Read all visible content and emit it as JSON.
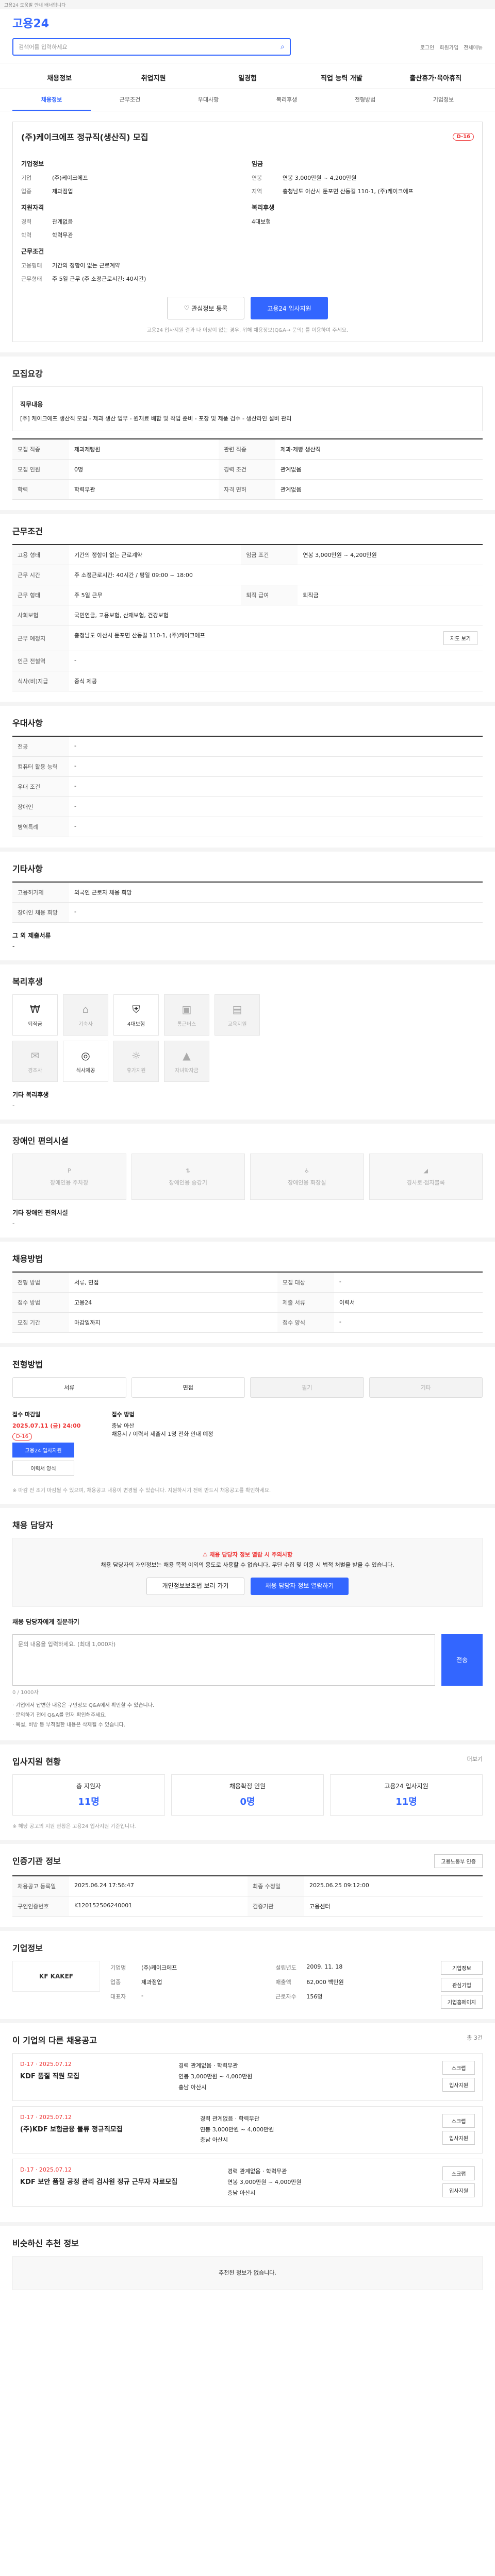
{
  "topbar": {
    "text": "고용24 도움말 안내 배너입니다"
  },
  "search": {
    "placeholder": "검색어를 입력하세요",
    "icon": "search-icon"
  },
  "util": [
    "로그인",
    "회원가입",
    "전체메뉴"
  ],
  "logo": "고용24",
  "gnb": [
    "채용정보",
    "취업지원",
    "일경험",
    "직업 능력 개발",
    "출산휴가·육아휴직"
  ],
  "tabs": [
    "채용정보",
    "근무조건",
    "우대사항",
    "복리후생",
    "전형방법",
    "기업정보"
  ],
  "job": {
    "title": "(주)케이크에프 정규직(생산직) 모집",
    "dday": "D-16",
    "company_label": "기업정보",
    "company_rows": [
      {
        "k": "기업",
        "v": "(주)케이크에프"
      },
      {
        "k": "업종",
        "v": "제과점업"
      }
    ],
    "cond_label": "근무조건",
    "cond_rows": [
      {
        "k": "고용형태",
        "v": "기간의 정함이 없는 근로계약"
      },
      {
        "k": "근무형태",
        "v": "주 5일 근무 (주 소정근로시간: 40시간)"
      }
    ],
    "req_label": "지원자격",
    "req_rows": [
      {
        "k": "경력",
        "v": "관계없음"
      },
      {
        "k": "학력",
        "v": "학력무관"
      }
    ],
    "wage_label": "임금",
    "wage_rows": [
      {
        "k": "연봉",
        "v": "연봉 3,000만원 ~ 4,200만원"
      },
      {
        "k": "지역",
        "v": "충청남도 아산시 둔포면 산동길 110-1, (주)케이크에프"
      }
    ],
    "welfare_label": "복리후생",
    "welfare_rows": [
      {
        "k": "",
        "v": "4대보험"
      }
    ],
    "btn_scrap": "관심정보 등록",
    "btn_apply": "고용24 입사지원",
    "notice": "고용24 입사지원 결과 나 이상이 없는 경우, 위해 채용정보(Q&A→ 문의) 를 이용하여 주세요."
  },
  "recruit": {
    "h": "모집요강",
    "duty_h": "직무내용",
    "duty": "[주] 케이크에프 생산직 모집 - 제과 생산 업무 - 원재료 배합 및 작업 준비 - 포장 및 제품 검수 - 생산라인 설비 관리",
    "rows": [
      {
        "k": "모집 직종",
        "v": "제과제빵원"
      },
      {
        "k": "관련 직종",
        "v": "제과·제빵 생산직"
      },
      {
        "k": "모집 인원",
        "v": "0명"
      },
      {
        "k": "경력 조건",
        "v": "관계없음"
      },
      {
        "k": "학력",
        "v": "학력무관"
      },
      {
        "k": "자격 면허",
        "v": "관계없음"
      }
    ]
  },
  "workcond": {
    "h": "근무조건",
    "rows": [
      {
        "k": "고용 형태",
        "v": "기간의 정함이 없는 근로계약"
      },
      {
        "k": "임금 조건",
        "v": "연봉 3,000만원 ~ 4,200만원"
      },
      {
        "k": "근무 시간",
        "v": "주 소정근로시간: 40시간 / 평일 09:00 ~ 18:00"
      },
      {
        "k": "근무 형태",
        "v": "주 5일 근무"
      },
      {
        "k": "퇴직 급여",
        "v": "퇴직금"
      },
      {
        "k": "사회보험",
        "v": "국민연금, 고용보험, 산재보험, 건강보험"
      },
      {
        "k": "근무 예정지",
        "v": "충청남도 아산시 둔포면 산동길 110-1, (주)케이크에프"
      },
      {
        "k": "인근 전철역",
        "v": "-"
      },
      {
        "k": "식사(비)지급",
        "v": "중식 제공"
      }
    ],
    "map_btn": "지도 보기"
  },
  "prefer": {
    "h": "우대사항",
    "rows": [
      {
        "k": "전공",
        "v": "-"
      },
      {
        "k": "컴퓨터 활용 능력",
        "v": "-"
      },
      {
        "k": "우대 조건",
        "v": "-"
      },
      {
        "k": "장애인",
        "v": "-"
      },
      {
        "k": "병역특례",
        "v": "-"
      }
    ]
  },
  "etc": {
    "h": "기타사항",
    "rows": [
      {
        "k": "고용허가제",
        "v": "외국인 근로자 채용 희망"
      },
      {
        "k": "장애인 채용 희망",
        "v": "-"
      }
    ],
    "sub": "그 외 제출서류",
    "subv": "-"
  },
  "welfare": {
    "h": "복리후생",
    "items_on": [
      "퇴직금",
      "4대보험",
      "식사제공"
    ],
    "items_off": [
      "기숙사",
      "통근버스",
      "교육지원",
      "경조사",
      "휴가지원",
      "자녀학자금"
    ],
    "other_label": "기타 복리후생",
    "other": "-"
  },
  "disabled": {
    "h": "장애인 편의시설",
    "items": [
      "장애인용 주차장",
      "장애인용 승강기",
      "장애인용 화장실",
      "경사로·점자블록"
    ],
    "other_label": "기타 장애인 편의시설",
    "other": "-"
  },
  "select": {
    "h": "채용방법",
    "rows": [
      {
        "k": "전형 방법",
        "v": "서류, 면접"
      },
      {
        "k": "모집 대상",
        "v": "-"
      },
      {
        "k": "접수 방법",
        "v": "고용24"
      },
      {
        "k": "제출 서류",
        "v": "이력서"
      },
      {
        "k": "모집 기간",
        "v": "마감일까지"
      },
      {
        "k": "접수 양식",
        "v": "-"
      }
    ]
  },
  "apply": {
    "h": "전형방법",
    "methods_on": [
      "서류",
      "면접"
    ],
    "methods_off": [
      "필기",
      "기타"
    ],
    "period_label": "접수 마감일",
    "period": "2025.07.11 (금) 24:00",
    "dday": "D-16",
    "apply_btn": "고용24 입사지원",
    "form_btn": "이력서 양식",
    "cont_label": "접수 방법",
    "cont": "채용시 / 이력서 제출시 1명 전화 안내 예정",
    "cont_tel": "충남 아산",
    "note": "※ 마감 전 조기 마감될 수 있으며, 채용공고 내용이 변경될 수 있습니다. 지원하시기 전에 반드시 채용공고를 확인하세요."
  },
  "safe": {
    "h": "채용 담당자",
    "warn": "채용 담당자 정보 열람 시 주의사항",
    "text": "채용 담당자의 개인정보는 채용 목적 이외의 용도로 사용할 수 없습니다. 무단 수집 및 이용 시 법적 처벌을 받을 수 있습니다.",
    "btn1": "개인정보보호법 보러 가기",
    "btn2": "채용 담당자 정보 열람하기"
  },
  "inquiry": {
    "label": "채용 담당자에게 질문하기",
    "placeholder": "문의 내용을 입력하세요. (최대 1,000자)",
    "count": "0 / 1000자",
    "send": "전송",
    "note1": "· 기업에서 답변한 내용은 구인정보 Q&A에서 확인할 수 있습니다.",
    "note2": "· 문의하기 전에 Q&A를 먼저 확인해주세요.",
    "note3": "· 욕설, 비방 등 부적절한 내용은 삭제될 수 있습니다."
  },
  "stats": {
    "h": "입사지원 현황",
    "more": "더보기",
    "items": [
      {
        "label": "총 지원자",
        "num": "11명"
      },
      {
        "label": "채용확정 인원",
        "num": "0명"
      },
      {
        "label": "고용24 입사지원",
        "num": "11명"
      }
    ],
    "note": "※ 해당 공고의 지원 현황은 고용24 입사지원 기준입니다."
  },
  "manage": {
    "h": "인증기관 정보",
    "badge": "고용노동부 인증",
    "rows": [
      {
        "k": "채용공고 등록일",
        "v": "2025.06.24 17:56:47"
      },
      {
        "k": "구인인증번호",
        "v": "K120152506240001"
      },
      {
        "k": "최종 수정일",
        "v": "2025.06.25 09:12:00"
      },
      {
        "k": "검증기관",
        "v": "고용센터"
      }
    ]
  },
  "company": {
    "h": "기업정보",
    "logo_text": "KF KAKEF",
    "rows": [
      {
        "k": "기업명",
        "v": "(주)케이크에프"
      },
      {
        "k": "업종",
        "v": "제과점업"
      },
      {
        "k": "대표자",
        "v": "-"
      },
      {
        "k": "설립년도",
        "v": "2009. 11. 18"
      },
      {
        "k": "매출액",
        "v": "62,000 백만원"
      },
      {
        "k": "근로자수",
        "v": "156명"
      }
    ],
    "btn1": "기업정보",
    "btn2": "관심기업",
    "btn3": "기업홈페이지"
  },
  "others": {
    "h": "이 기업의 다른 채용공고",
    "more": "총 3건",
    "items": [
      {
        "date": "D-17 · 2025.07.12",
        "title": "KDF 품질 직원 모집",
        "meta1": "경력 관계없음 · 학력무관",
        "meta2": "연봉 3,000만원 ~ 4,000만원",
        "meta3": "충남 아산시"
      },
      {
        "date": "D-17 · 2025.07.12",
        "title": "(주)KDF 보험금융 물류 정규직모집",
        "meta1": "경력 관계없음 · 학력무관",
        "meta2": "연봉 3,000만원 ~ 4,000만원",
        "meta3": "충남 아산시"
      },
      {
        "date": "D-17 · 2025.07.12",
        "title": "KDF 보안 품질 공정 관리 검사원 정규 근무자 자료모집",
        "meta1": "경력 관계없음 · 학력무관",
        "meta2": "연봉 3,000만원 ~ 4,000만원",
        "meta3": "충남 아산시"
      }
    ],
    "btn_scrap": "스크랩",
    "btn_apply": "입사지원"
  },
  "recommend": {
    "h": "비슷하신 추천 정보",
    "empty": "추천된 정보가 없습니다."
  }
}
